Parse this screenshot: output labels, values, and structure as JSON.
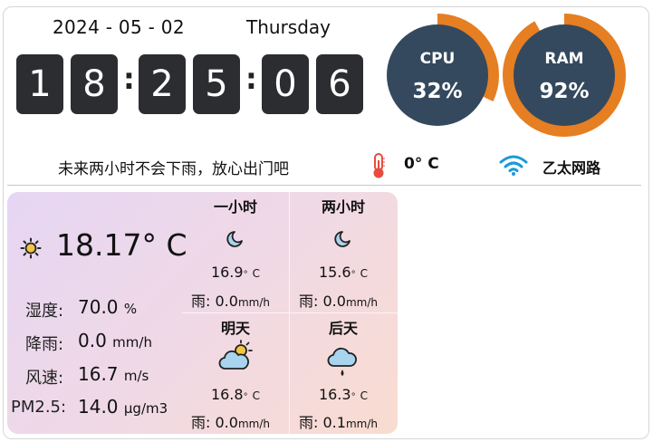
{
  "clock": {
    "date": "2024 - 05 - 02",
    "weekday": "Thursday",
    "digits": [
      "1",
      "8",
      "2",
      "5",
      "0",
      "6"
    ],
    "separator": ":"
  },
  "system": {
    "cpu": {
      "label": "CPU",
      "value": "32%",
      "percent": 32
    },
    "ram": {
      "label": "RAM",
      "value": "92%",
      "percent": 92
    },
    "ring_color": "#e67e22",
    "inner_color": "#34495e"
  },
  "status": {
    "message": "未来两小时不会下雨，放心出门吧",
    "outdoor_temp": "0° C",
    "network": "乙太网路",
    "icons": {
      "temperature": "thermometer-icon",
      "network": "wifi-icon"
    }
  },
  "current": {
    "icon": "sun-icon",
    "temperature": "18.17° C",
    "metrics": [
      {
        "label": "湿度:",
        "value": "70.0",
        "unit": "%"
      },
      {
        "label": "降雨:",
        "value": "0.0",
        "unit": "mm/h"
      },
      {
        "label": "风速:",
        "value": "16.7",
        "unit": "m/s"
      },
      {
        "label": "PM2.5:",
        "value": "14.0",
        "unit": "μg/m3"
      }
    ]
  },
  "forecast": [
    {
      "title": "一小时",
      "icon": "moon-icon",
      "temp": "16.9",
      "deg": "°",
      "unit": "C",
      "rain_label": "雨:",
      "rain": "0.0",
      "rain_unit": "mm/h"
    },
    {
      "title": "两小时",
      "icon": "moon-icon",
      "temp": "15.6",
      "deg": "°",
      "unit": "C",
      "rain_label": "雨:",
      "rain": "0.0",
      "rain_unit": "mm/h"
    },
    {
      "title": "明天",
      "icon": "cloud-sun-icon",
      "temp": "16.8",
      "deg": "°",
      "unit": "C",
      "rain_label": "雨:",
      "rain": "0.0",
      "rain_unit": "mm/h"
    },
    {
      "title": "后天",
      "icon": "cloud-rain-icon",
      "temp": "16.3",
      "deg": "°",
      "unit": "C",
      "rain_label": "雨:",
      "rain": "0.1",
      "rain_unit": "mm/h"
    }
  ]
}
